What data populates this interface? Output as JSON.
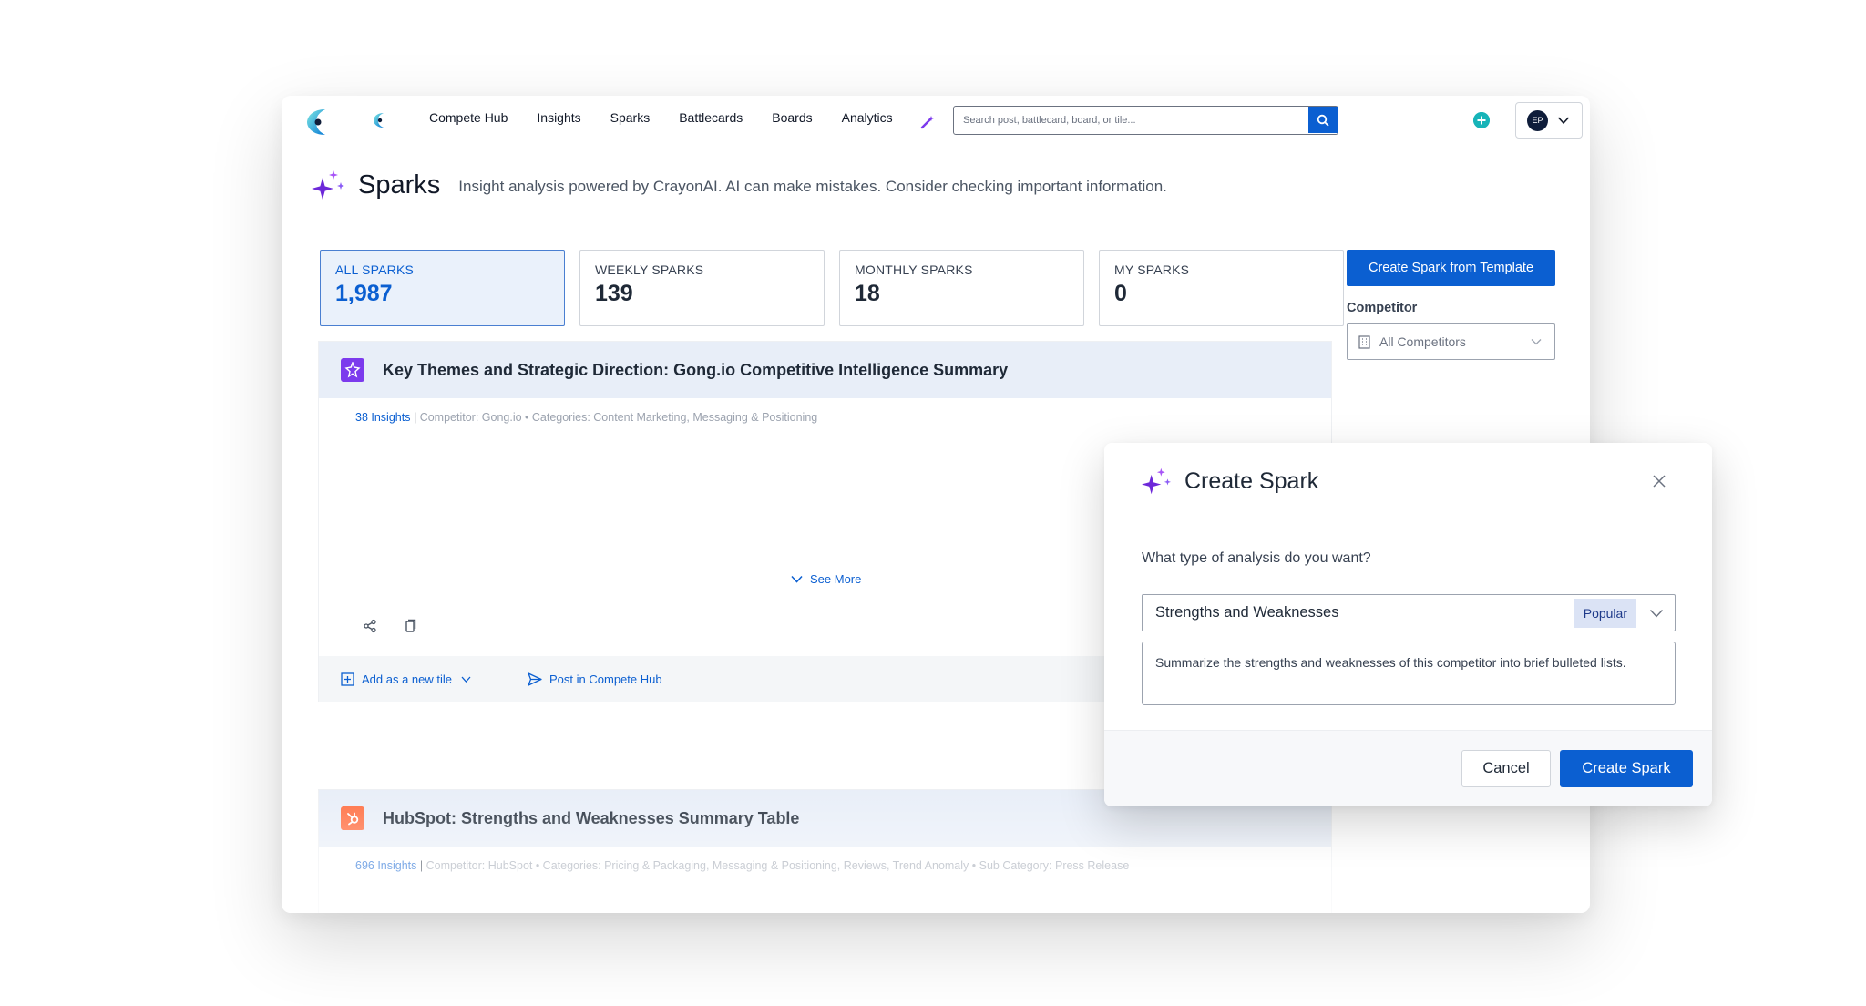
{
  "nav": {
    "links": [
      "Compete Hub",
      "Insights",
      "Sparks",
      "Battlecards",
      "Boards",
      "Analytics"
    ],
    "search_placeholder": "Search post, battlecard, board, or tile...",
    "avatar_initials": "EP"
  },
  "page": {
    "title": "Sparks",
    "subtitle": "Insight analysis powered by CrayonAI. AI can make mistakes. Consider checking important information."
  },
  "stats": [
    {
      "label": "ALL SPARKS",
      "value": "1,987",
      "active": true
    },
    {
      "label": "WEEKLY SPARKS",
      "value": "139",
      "active": false
    },
    {
      "label": "MONTHLY SPARKS",
      "value": "18",
      "active": false
    },
    {
      "label": "MY SPARKS",
      "value": "0",
      "active": false
    }
  ],
  "sidebar": {
    "template_button": "Create Spark from Template",
    "competitor_label": "Competitor",
    "competitor_value": "All Competitors"
  },
  "cards": [
    {
      "title": "Key Themes and Strategic Direction: Gong.io Competitive Intelligence Summary",
      "insights": "38 Insights",
      "meta": "Competitor: Gong.io • Categories: Content Marketing, Messaging & Positioning",
      "see_more": "See More",
      "add_tile": "Add as a new tile",
      "post": "Post in Compete Hub"
    },
    {
      "title": "HubSpot: Strengths and Weaknesses Summary Table",
      "insights": "696 Insights",
      "meta": "Competitor: HubSpot • Categories: Pricing & Packaging, Messaging & Positioning, Reviews, Trend Anomaly • Sub Category: Press Release"
    }
  ],
  "modal": {
    "title": "Create Spark",
    "question": "What type of analysis do you want?",
    "selected_analysis": "Strengths and Weaknesses",
    "badge": "Popular",
    "prompt": "Summarize the strengths and weaknesses of this competitor into brief bulleted lists.",
    "cancel": "Cancel",
    "create": "Create Spark"
  },
  "colors": {
    "primary": "#0b5fd1",
    "active_tile_bg": "#eaf1fb",
    "card_header_bg": "#e8eef8",
    "spark_purple": "#7c3aed",
    "hubspot_orange": "#ff6b3d",
    "teal": "#17b4b8"
  }
}
